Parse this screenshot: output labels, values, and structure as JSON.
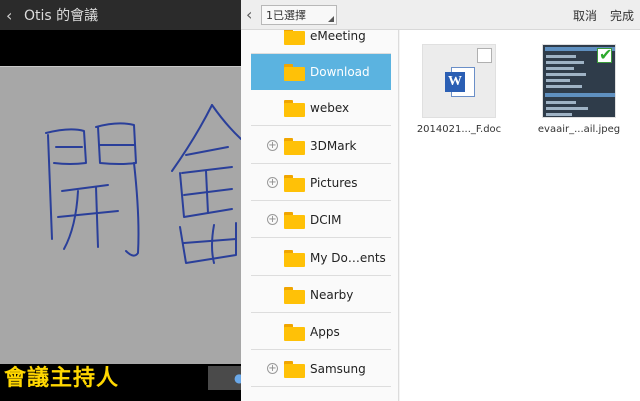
{
  "background_app": {
    "title": "Otis 的會議",
    "back_glyph": "‹",
    "host_label": "會議主持人",
    "canvas_handwriting": "開會"
  },
  "picker": {
    "back_glyph": "‹",
    "selection_label": "1已選擇",
    "cancel_label": "取消",
    "done_label": "完成",
    "accent_color": "#5bb3e0",
    "folder_color": "#ffc107",
    "folders": [
      {
        "name": "eMeeting",
        "expandable": false,
        "selected": false
      },
      {
        "name": "Download",
        "expandable": false,
        "selected": true
      },
      {
        "name": "webex",
        "expandable": false,
        "selected": false
      },
      {
        "name": "3DMark",
        "expandable": true,
        "selected": false
      },
      {
        "name": "Pictures",
        "expandable": true,
        "selected": false
      },
      {
        "name": "DCIM",
        "expandable": true,
        "selected": false
      },
      {
        "name": "My Do…ents",
        "expandable": false,
        "selected": false
      },
      {
        "name": "Nearby",
        "expandable": false,
        "selected": false
      },
      {
        "name": "Apps",
        "expandable": false,
        "selected": false
      },
      {
        "name": "Samsung",
        "expandable": true,
        "selected": false
      }
    ],
    "files": [
      {
        "name": "2014021..._F.doc",
        "type": "word-doc",
        "checked": false
      },
      {
        "name": "evaair_...ail.jpeg",
        "type": "jpeg",
        "checked": true
      }
    ],
    "word_icon_letter": "W",
    "check_glyph": "✔",
    "expand_glyph": "+"
  }
}
